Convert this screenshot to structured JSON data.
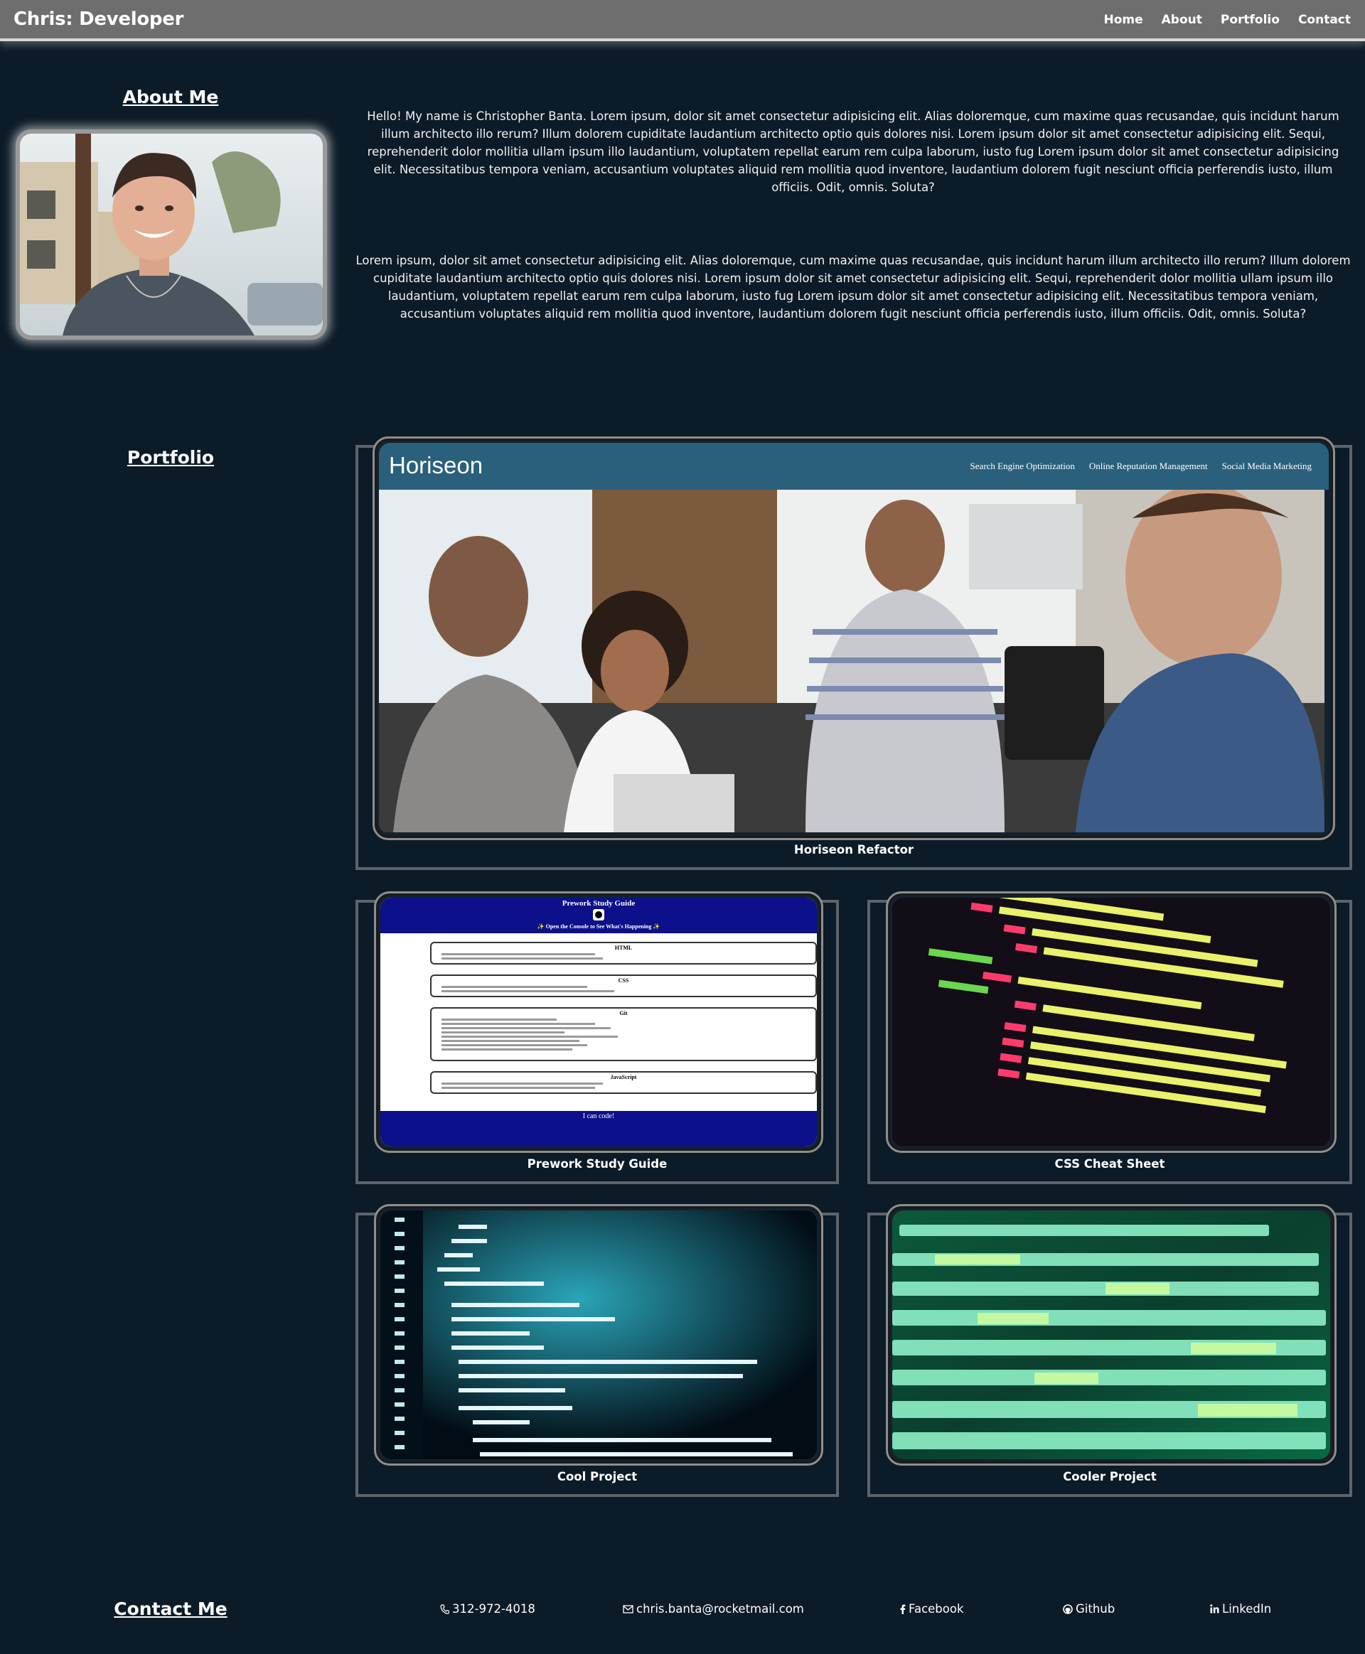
{
  "header": {
    "brand": "Chris: Developer",
    "nav": [
      "Home",
      "About",
      "Portfolio",
      "Contact"
    ]
  },
  "about": {
    "title": "About Me",
    "paragraph_1": "Hello! My name is Christopher Banta. Lorem ipsum, dolor sit amet consectetur adipisicing elit. Alias doloremque, cum maxime quas recusandae, quis incidunt harum illum architecto illo rerum? Illum dolorem cupiditate laudantium architecto optio quis dolores nisi. Lorem ipsum dolor sit amet consectetur adipisicing elit. Sequi, reprehenderit dolor mollitia ullam ipsum illo laudantium, voluptatem repellat earum rem culpa laborum, iusto fug Lorem ipsum dolor sit amet consectetur adipisicing elit. Necessitatibus tempora veniam, accusantium voluptates aliquid rem mollitia quod inventore, laudantium dolorem fugit nesciunt officia perferendis iusto, illum officiis. Odit, omnis. Soluta?",
    "paragraph_2": "Lorem ipsum, dolor sit amet consectetur adipisicing elit. Alias doloremque, cum maxime quas recusandae, quis incidunt harum illum architecto illo rerum? Illum dolorem cupiditate laudantium architecto optio quis dolores nisi. Lorem ipsum dolor sit amet consectetur adipisicing elit. Sequi, reprehenderit dolor mollitia ullam ipsum illo laudantium, voluptatem repellat earum rem culpa laborum, iusto fug Lorem ipsum dolor sit amet consectetur adipisicing elit. Necessitatibus tempora veniam, accusantium voluptates aliquid rem mollitia quod inventore, laudantium dolorem fugit nesciunt officia perferendis iusto, illum officiis. Odit, omnis. Soluta?"
  },
  "portfolio": {
    "title": "Portfolio",
    "projects": [
      {
        "caption": "Horiseon Refactor",
        "screenshot": {
          "logo": "Horiseon",
          "nav": [
            "Search Engine Optimization",
            "Online Reputation Management",
            "Social Media Marketing"
          ]
        }
      },
      {
        "caption": "Prework Study Guide",
        "screenshot": {
          "title": "Prework Study Guide",
          "subtitle": "✨ Open the Console to See What's Happening ✨",
          "sections": [
            "HTML",
            "CSS",
            "Git",
            "JavaScript"
          ],
          "footer": "I can code!"
        }
      },
      {
        "caption": "CSS Cheat Sheet"
      },
      {
        "caption": "Cool Project"
      },
      {
        "caption": "Cooler Project"
      }
    ]
  },
  "contact": {
    "title": "Contact Me",
    "phone": "312-972-4018",
    "email": "chris.banta@rocketmail.com",
    "facebook": "Facebook",
    "github": "Github",
    "linkedin": "LinkedIn",
    "icons": [
      "phone-icon",
      "email-icon",
      "facebook-icon",
      "github-icon",
      "linkedin-icon"
    ]
  },
  "colors": {
    "background": "#0b1b27",
    "header": "#6e6e6e",
    "horiseon_bar": "#2a607c",
    "prework_blue": "#0c108a"
  }
}
